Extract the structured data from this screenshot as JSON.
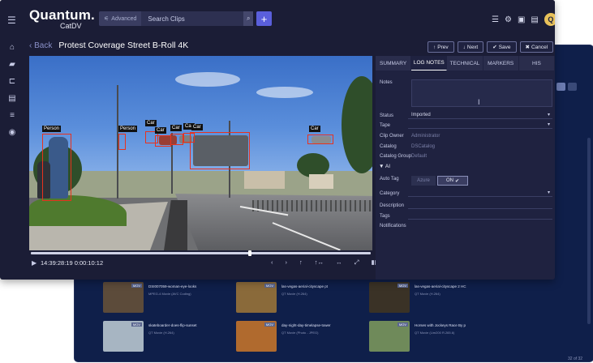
{
  "back_window": {
    "header_icons": [
      "chevron-down-icon",
      "gear-icon"
    ],
    "avatar": "Q",
    "thumbnails": [
      {
        "title": "DSI007059-woman-eye-looks",
        "sub": "MPEG-4 Movie (AVC Coding)",
        "badge": "MOV",
        "color": "#5c4b3a"
      },
      {
        "title": "las-vegas-aerial-cityscape pt",
        "sub": "QT Movie (H.264)",
        "badge": "MOV",
        "color": "#8a6a3a"
      },
      {
        "title": "las-vegas-aerial-cityscape 2 HC",
        "sub": "QT Movie (H.264)",
        "badge": "MOV",
        "color": "#3a3226"
      },
      {
        "title": "skateboarder-does-flip-sunset",
        "sub": "QT Movie (H.264)",
        "badge": "MOV",
        "color": "#a7b5c2"
      },
      {
        "title": "day-night-day-timelapse-tower",
        "sub": "QT Movie (Photo - JPEG)",
        "badge": "MOV",
        "color": "#b06a2e"
      },
      {
        "title": "Horses with Jockeys Race By p",
        "sub": "QT Movie (Lim200 R.265.6)",
        "badge": "MOV",
        "color": "#6f8a5a"
      }
    ],
    "pager": "32 of 32"
  },
  "topbar": {
    "logo": "Quantum.",
    "logo_sub": "CatDV",
    "advanced_label": "Advanced",
    "search_placeholder": "Search Clips",
    "plus_label": "+",
    "avatar": "Q"
  },
  "sidenav": [
    "home-icon",
    "briefcase-icon",
    "hierarchy-icon",
    "list-icon",
    "menu-list-icon",
    "check-circle-icon"
  ],
  "clip": {
    "back_label": "Back",
    "title": "Protest Coverage Street B-Roll 4K"
  },
  "nav_buttons": [
    {
      "label": "Prev",
      "glyph": "↑",
      "name": "prev-button"
    },
    {
      "label": "Next",
      "glyph": "↓",
      "name": "next-button"
    },
    {
      "label": "Save",
      "glyph": "✔",
      "name": "save-button"
    },
    {
      "label": "Cancel",
      "glyph": "✖",
      "name": "cancel-button"
    }
  ],
  "detections": [
    {
      "label": "Person"
    },
    {
      "label": "Person"
    },
    {
      "label": "Car"
    },
    {
      "label": "Car"
    },
    {
      "label": "Car"
    },
    {
      "label": "Car"
    },
    {
      "label": "Car"
    },
    {
      "label": "Car"
    }
  ],
  "player": {
    "timecode": "14:39:28:19 0:00:10:12",
    "playhead_fraction": 0.64
  },
  "panel": {
    "tabs": [
      "SUMMARY",
      "LOG NOTES",
      "TECHNICAL",
      "MARKERS",
      "HIS"
    ],
    "active_tab": 1,
    "fields": {
      "notes_label": "Notes",
      "status_label": "Status",
      "status_value": "Imported",
      "tape_label": "Tape",
      "clip_owner_label": "Clip Owner",
      "clip_owner_value": "Administrator",
      "catalog_label": "Catalog",
      "catalog_value": "DSCatalog",
      "catalog_group_label": "Catalog Group",
      "catalog_group_value": "Default",
      "ai_label": "AI",
      "auto_tag_label": "Auto Tag",
      "azure_label": "Azure",
      "on_label": "ON",
      "category_label": "Category",
      "description_label": "Description",
      "tags_label": "Tags",
      "notifications_label": "Notifications"
    }
  }
}
